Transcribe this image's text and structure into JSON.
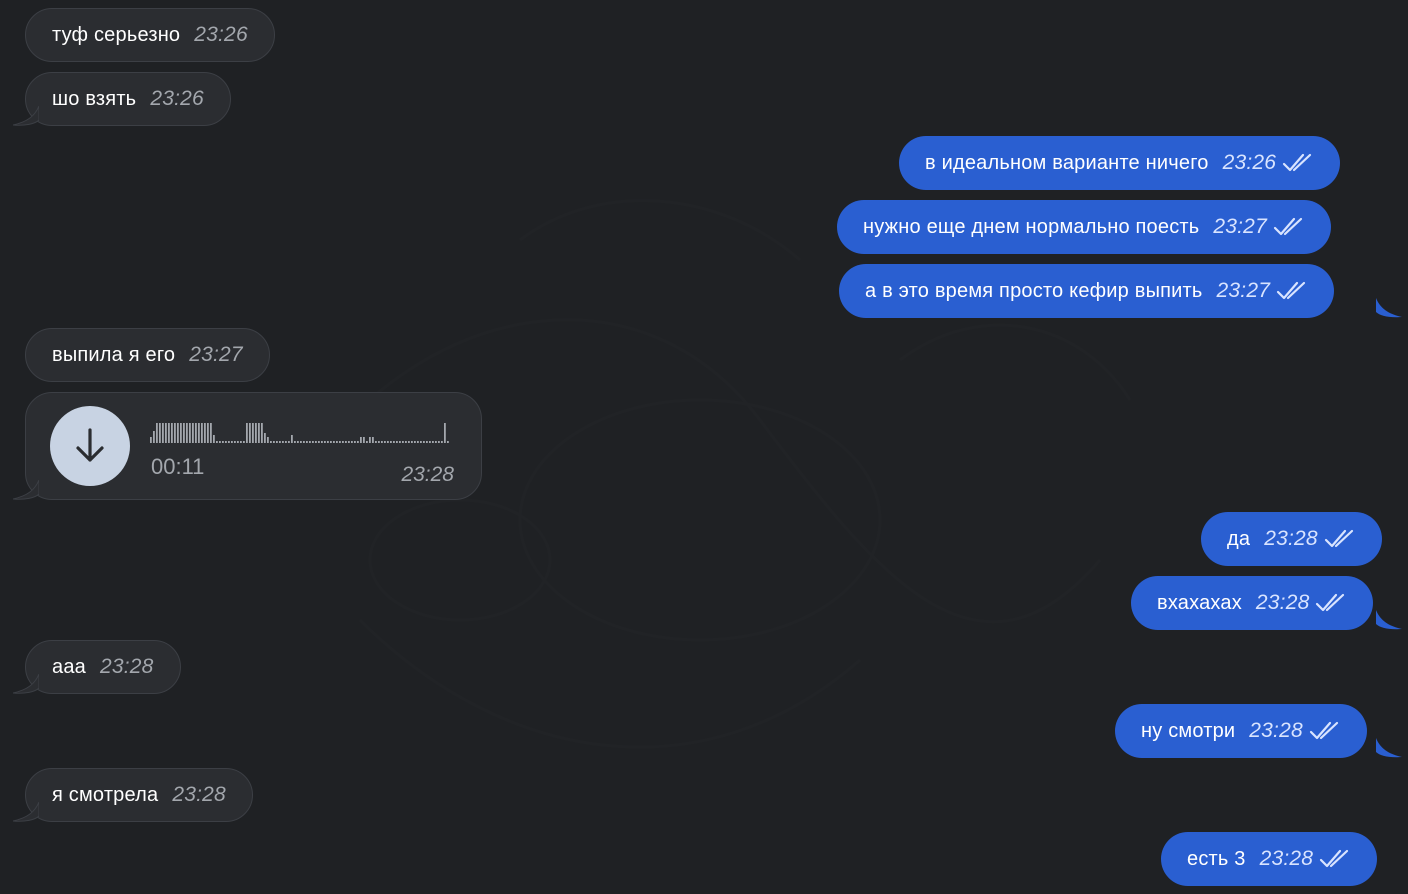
{
  "messages": [
    {
      "text": "туф серьезно",
      "time": "23:26"
    },
    {
      "text": "шо взять",
      "time": "23:26"
    },
    {
      "text": "в идеальном варианте ничего",
      "time": "23:26"
    },
    {
      "text": "нужно еще днем нормально поесть",
      "time": "23:27"
    },
    {
      "text": "а в это время просто кефир выпить",
      "time": "23:27"
    },
    {
      "text": "выпила я его",
      "time": "23:27"
    },
    {
      "text": "да",
      "time": "23:28"
    },
    {
      "text": "вхахахах",
      "time": "23:28"
    },
    {
      "text": "ааа",
      "time": "23:28"
    },
    {
      "text": "ну смотри",
      "time": "23:28"
    },
    {
      "text": "я смотрела",
      "time": "23:28"
    },
    {
      "text": "есть 3",
      "time": "23:28"
    }
  ],
  "voice": {
    "duration": "00:11",
    "time": "23:28",
    "icon": "download-arrow-icon"
  },
  "icons": {
    "read_status": "double-check-icon"
  },
  "colors": {
    "background": "#1f2124",
    "incoming_bubble": "#2b2d31",
    "outgoing_bubble": "#2a5fd1",
    "incoming_time": "#a3a7ad",
    "download_button": "#c8d3e3"
  }
}
